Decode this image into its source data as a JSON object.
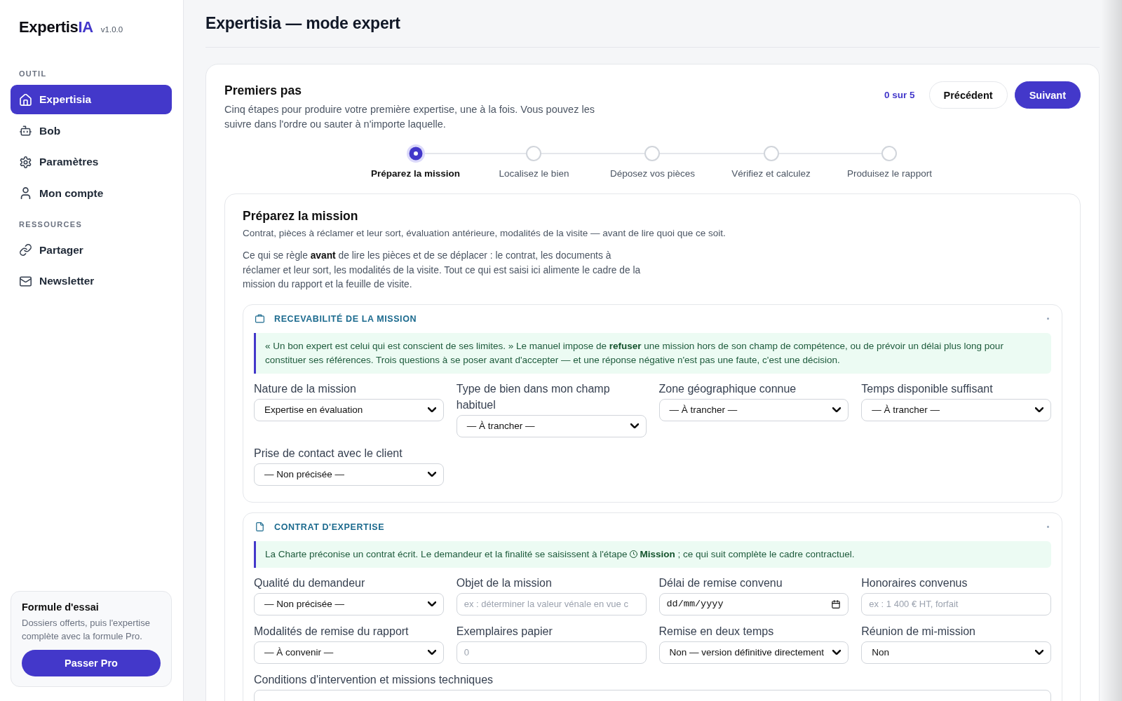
{
  "sidebar": {
    "logo": {
      "name": "Expertis",
      "accent": "IA",
      "version": "v1.0.0"
    },
    "groups": [
      {
        "heading": "OUTIL",
        "items": [
          {
            "label": "Expertisia",
            "selected": true
          },
          {
            "label": "Bob",
            "selected": false
          },
          {
            "label": "Paramètres",
            "selected": false
          },
          {
            "label": "Mon compte",
            "selected": false
          }
        ]
      },
      {
        "heading": "RESSOURCES",
        "items": [
          {
            "label": "Partager",
            "selected": false
          },
          {
            "label": "Newsletter",
            "selected": false
          }
        ]
      }
    ],
    "trial_card": {
      "title": "Formule d'essai",
      "text": "Dossiers offerts, puis l'expertise complète avec la formule Pro.",
      "button": "Passer Pro"
    }
  },
  "page": {
    "title": "Expertisia — mode expert"
  },
  "onboarding": {
    "title": "Premiers pas",
    "description": "Cinq étapes pour produire votre première expertise, une à la fois. Vous pouvez les suivre dans l'ordre ou sauter à n'importe laquelle.",
    "progress": "0 sur 5",
    "buttons": [
      {
        "label": "Précédent",
        "kind": "secondary"
      },
      {
        "label": "Suivant",
        "kind": "primary"
      }
    ],
    "steps": [
      {
        "label": "Préparez la mission",
        "selected": true
      },
      {
        "label": "Localisez le bien",
        "selected": false
      },
      {
        "label": "Déposez vos pièces",
        "selected": false
      },
      {
        "label": "Vérifiez et calculez",
        "selected": false
      },
      {
        "label": "Produisez le rapport",
        "selected": false
      }
    ],
    "step_panel": {
      "title": "Préparez la mission",
      "subtitle": "Contrat, pièces à réclamer et leur sort, évaluation antérieure, modalités de la visite — avant de lire quoi que ce soit.",
      "intro": "Ce qui se règle **avant** de lire les pièces et de se déplacer : le contrat, les documents à réclamer et leur sort, les modalités de la visite. Tout ce qui est saisi ici alimente le cadre de la mission du rapport et la feuille de visite.",
      "sections": [
        {
          "title": "RECEVABILITÉ DE LA MISSION",
          "callout": {
            "text": "« Un bon expert est celui qui est conscient de ses limites. » Le manuel impose de **refuser** une mission hors de son champ de compétence, ou de prévoir un délai plus long pour constituer ses références. Trois questions à se poser avant d'accepter — et une réponse négative n'est pas une faute, c'est une décision."
          },
          "fields": [
            {
              "kind": "select",
              "label": "Nature de la mission",
              "value": "Expertise en évaluation"
            },
            {
              "kind": "select",
              "label": "Type de bien dans mon champ habituel",
              "value": "— À trancher —"
            },
            {
              "kind": "select",
              "label": "Zone géographique connue",
              "value": "— À trancher —"
            },
            {
              "kind": "select",
              "label": "Temps disponible suffisant",
              "value": "— À trancher —"
            },
            {
              "kind": "select",
              "label": "Prise de contact avec le client",
              "value": "— Non précisée —"
            }
          ]
        },
        {
          "title": "CONTRAT D'EXPERTISE",
          "callout": {
            "text": "La Charte préconise un contrat écrit. Le demandeur et la finalité se saisissent à l'étape",
            "link": "Mission",
            "after": "; ce qui suit complète le cadre contractuel."
          },
          "fields": [
            {
              "kind": "select",
              "label": "Qualité du demandeur",
              "value": "— Non précisée —"
            },
            {
              "kind": "text",
              "label": "Objet de la mission",
              "placeholder": "ex : déterminer la valeur vénale en vue c"
            },
            {
              "kind": "date",
              "label": "Délai de remise convenu",
              "placeholder": "dd/mm/yyyy"
            },
            {
              "kind": "text",
              "label": "Honoraires convenus",
              "placeholder": "ex : 1 400 € HT, forfait"
            },
            {
              "kind": "select",
              "label": "Modalités de remise du rapport",
              "value": "— À convenir —"
            },
            {
              "kind": "text",
              "label": "Exemplaires papier",
              "placeholder": "0"
            },
            {
              "kind": "select",
              "label": "Remise en deux temps",
              "value": "Non — version définitive directement"
            },
            {
              "kind": "select",
              "label": "Réunion de mi-mission",
              "value": "Non"
            },
            {
              "kind": "textarea",
              "label": "Conditions d'intervention et missions techniques"
            }
          ]
        }
      ]
    }
  }
}
